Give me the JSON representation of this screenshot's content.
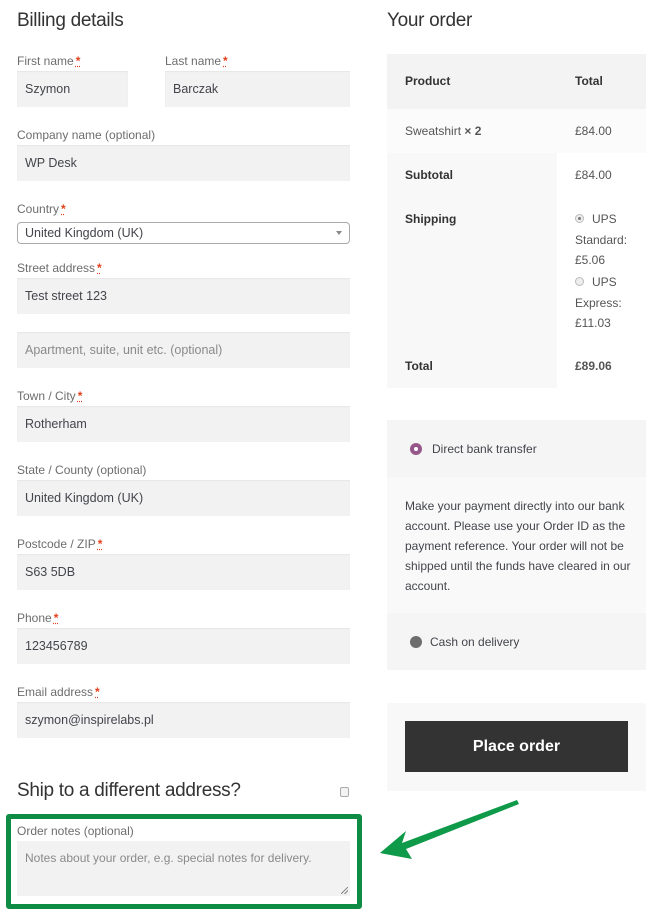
{
  "billing": {
    "title": "Billing details",
    "required_mark": "*",
    "first_name": {
      "label": "First name",
      "value": "Szymon"
    },
    "last_name": {
      "label": "Last name",
      "value": "Barczak"
    },
    "company": {
      "label": "Company name (optional)",
      "value": "WP Desk"
    },
    "country": {
      "label": "Country",
      "value": "United Kingdom (UK)"
    },
    "street": {
      "label": "Street address",
      "value": "Test street 123"
    },
    "street2": {
      "placeholder": "Apartment, suite, unit etc. (optional)"
    },
    "city": {
      "label": "Town / City",
      "value": "Rotherham"
    },
    "state": {
      "label": "State / County (optional)",
      "value": "United Kingdom (UK)"
    },
    "postcode": {
      "label": "Postcode / ZIP",
      "value": "S63 5DB"
    },
    "phone": {
      "label": "Phone",
      "value": "123456789"
    },
    "email": {
      "label": "Email address",
      "value": "szymon@inspirelabs.pl"
    }
  },
  "shipping": {
    "title": "Ship to a different address?",
    "checked": false
  },
  "notes": {
    "label": "Order notes (optional)",
    "placeholder": "Notes about your order, e.g. special notes for delivery."
  },
  "order": {
    "title": "Your order",
    "headers": {
      "product": "Product",
      "total": "Total"
    },
    "items": [
      {
        "name": "Sweatshirt",
        "qty": "× 2",
        "total": "£84.00"
      }
    ],
    "subtotal": {
      "label": "Subtotal",
      "value": "£84.00"
    },
    "shipping": {
      "label": "Shipping",
      "options": [
        {
          "line1": "UPS",
          "line2": "Standard:",
          "line3": "£5.06",
          "selected": true
        },
        {
          "line1": "UPS",
          "line2": "Express:",
          "line3": "£11.03",
          "selected": false
        }
      ]
    },
    "total": {
      "label": "Total",
      "value": "£89.06"
    }
  },
  "payment": {
    "methods": [
      {
        "label": "Direct bank transfer",
        "selected": true
      },
      {
        "label": "Cash on delivery",
        "selected": false
      }
    ],
    "description": "Make your payment directly into our bank account. Please use your Order ID as the payment reference. Your order will not be shipped until the funds have cleared in our account.",
    "place_order_label": "Place order"
  },
  "annotation": {
    "highlight_color": "#0e8c43"
  }
}
